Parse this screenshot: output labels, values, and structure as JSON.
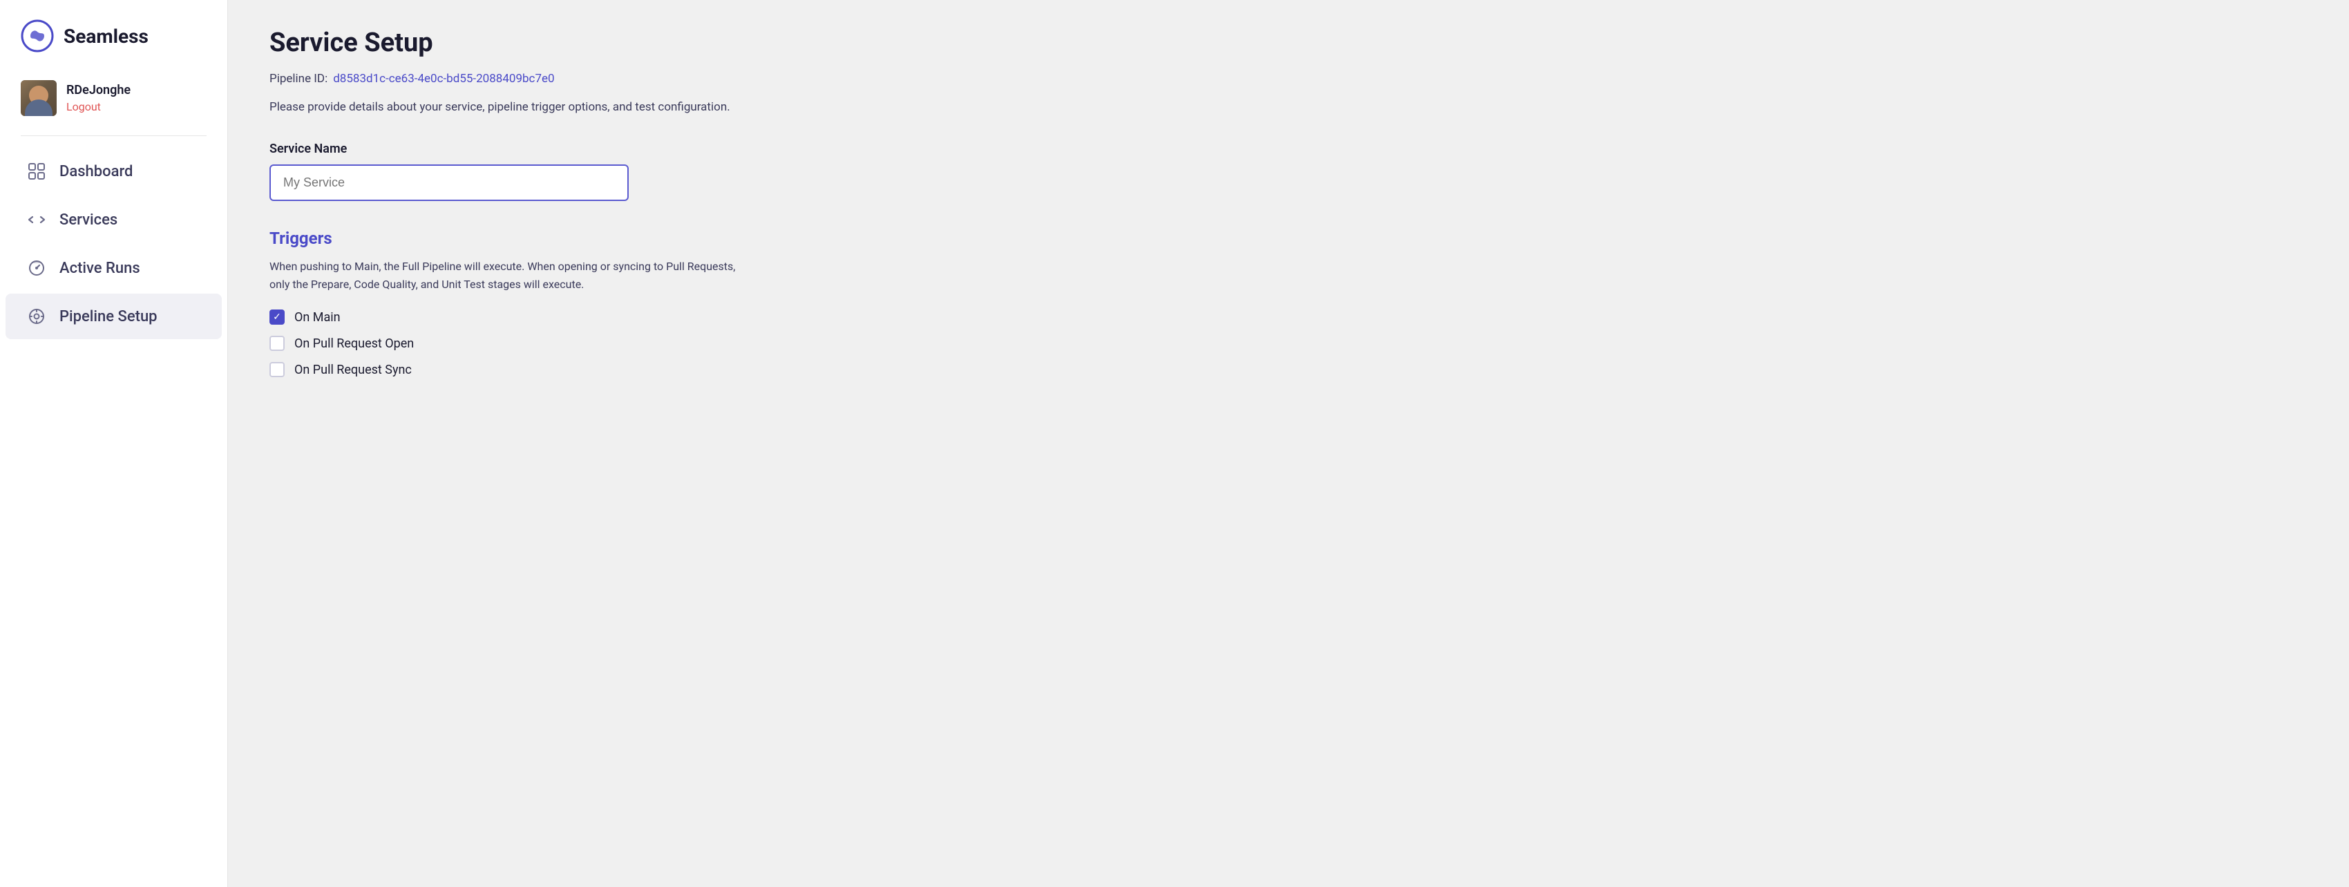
{
  "app": {
    "name": "Seamless"
  },
  "user": {
    "name": "RDeJonghe",
    "logout_label": "Logout"
  },
  "sidebar": {
    "nav_items": [
      {
        "id": "dashboard",
        "label": "Dashboard",
        "icon": "dashboard-icon"
      },
      {
        "id": "services",
        "label": "Services",
        "icon": "services-icon"
      },
      {
        "id": "active-runs",
        "label": "Active Runs",
        "icon": "active-runs-icon"
      },
      {
        "id": "pipeline-setup",
        "label": "Pipeline Setup",
        "icon": "pipeline-setup-icon"
      }
    ]
  },
  "main": {
    "page_title": "Service Setup",
    "pipeline_id_label": "Pipeline ID:",
    "pipeline_id_value": "d8583d1c-ce63-4e0c-bd55-2088409bc7e0",
    "description": "Please provide details about your service, pipeline trigger options, and test configuration.",
    "service_name_label": "Service Name",
    "service_name_placeholder": "My Service",
    "triggers_section_title": "Triggers",
    "triggers_description": "When pushing to Main, the Full Pipeline will execute. When opening or syncing to Pull Requests, only the Prepare, Code Quality, and Unit Test stages will execute.",
    "trigger_options": [
      {
        "id": "on-main",
        "label": "On Main",
        "checked": true
      },
      {
        "id": "on-pr-open",
        "label": "On Pull Request Open",
        "checked": false
      },
      {
        "id": "on-pr-sync",
        "label": "On Pull Request Sync",
        "checked": false
      }
    ]
  },
  "colors": {
    "accent": "#4a4ac8",
    "danger": "#e05555"
  }
}
